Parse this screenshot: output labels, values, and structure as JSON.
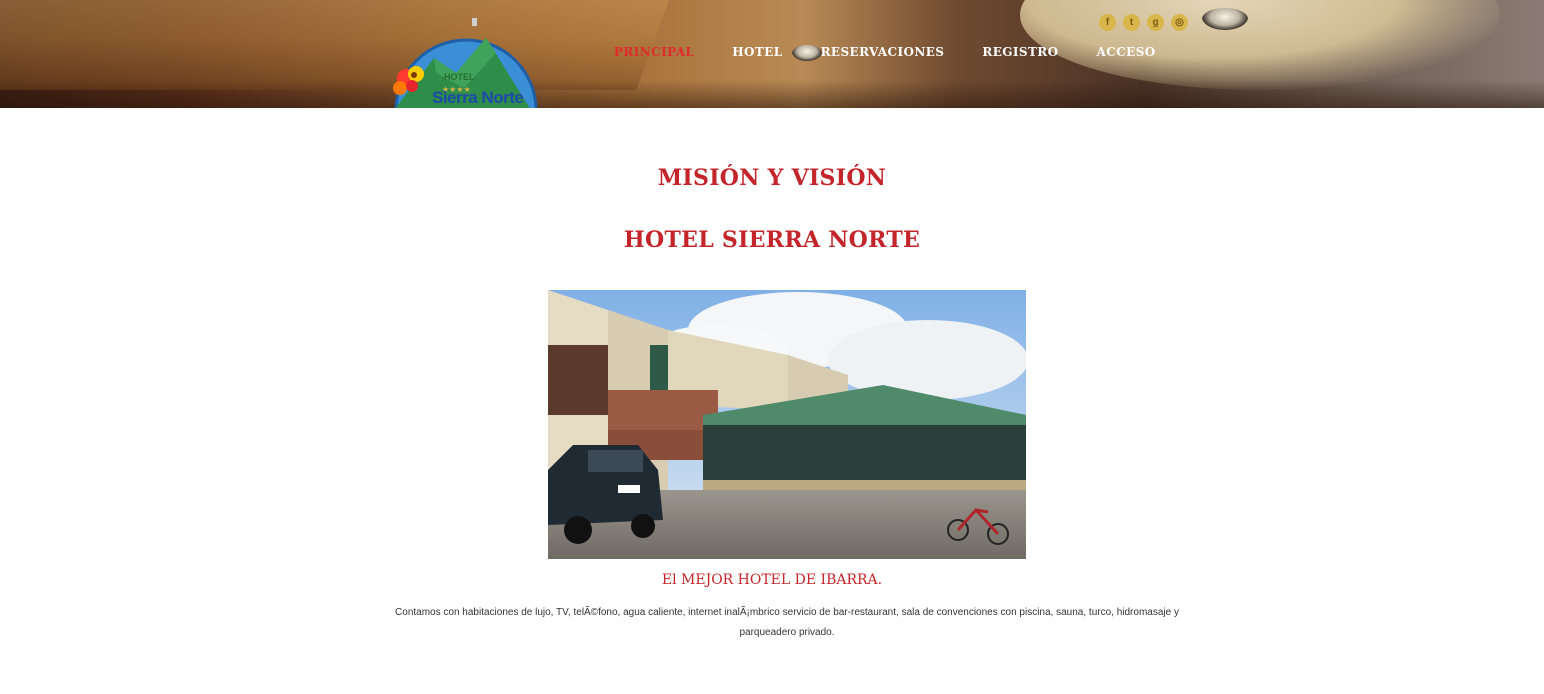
{
  "brand": {
    "logo_text": "Sierra Norte",
    "logo_small_text": "HOTEL"
  },
  "nav": {
    "items": [
      {
        "label": "PRINCIPAL",
        "active": true
      },
      {
        "label": "HOTEL",
        "active": false
      },
      {
        "label": "RESERVACIONES",
        "active": false
      },
      {
        "label": "REGISTRO",
        "active": false
      },
      {
        "label": "ACCESO",
        "active": false
      }
    ],
    "active_color": "#e02b2b"
  },
  "social": {
    "icons": [
      "facebook-icon",
      "twitter-icon",
      "google-plus-icon",
      "dribbble-icon"
    ],
    "glyphs": [
      "f",
      "t",
      "g",
      "◎"
    ],
    "color": "#d8b649"
  },
  "main": {
    "title": "MISIÓN Y VISIÓN",
    "subtitle": "HOTEL SIERRA NORTE",
    "photo_alt": "hotel-building-photo",
    "caption": "El MEJOR HOTEL DE IBARRA.",
    "description": "Contamos con habitaciones de lujo, TV, telÃ©fono, agua caliente, internet inalÃ¡mbrico servicio de bar-restaurant, sala de convenciones con piscina, sauna, turco, hidromasaje y parqueadero privado.",
    "accent_color": "#c4252b"
  }
}
